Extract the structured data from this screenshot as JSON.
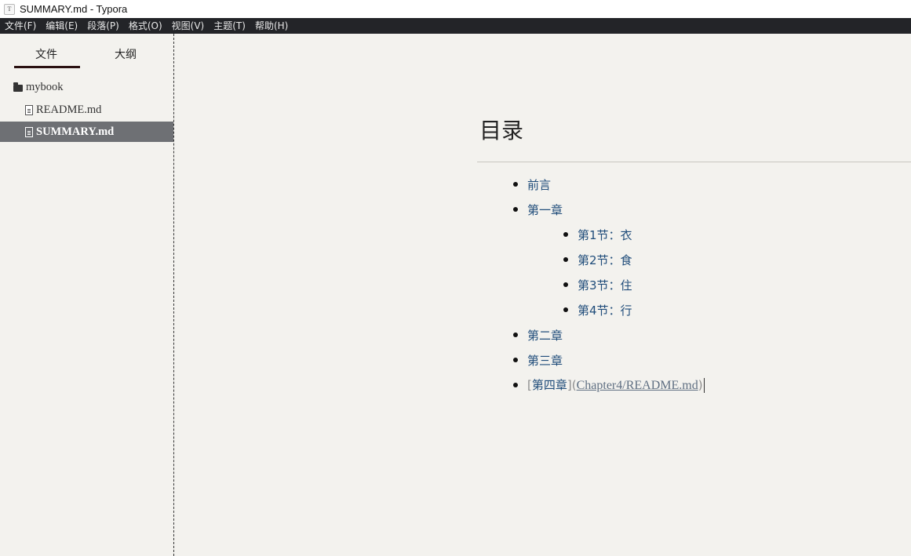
{
  "window": {
    "title": "SUMMARY.md - Typora",
    "icon": "T"
  },
  "menu": [
    "文件(F)",
    "编辑(E)",
    "段落(P)",
    "格式(O)",
    "视图(V)",
    "主题(T)",
    "帮助(H)"
  ],
  "sidebar": {
    "tabs": {
      "files": "文件",
      "outline": "大纲"
    },
    "tree": {
      "folder": "mybook",
      "files": [
        "README.md",
        "SUMMARY.md"
      ]
    }
  },
  "document": {
    "heading": "目录",
    "items": {
      "preface": "前言",
      "chapter1": "第一章",
      "sec1": "第1节：衣",
      "sec2": "第2节：食",
      "sec3": "第3节：住",
      "sec4": "第4节：行",
      "chapter2": "第二章",
      "chapter3": "第三章",
      "chapter4_open": "[",
      "chapter4_text": "第四章",
      "chapter4_mid": "](",
      "chapter4_url": "Chapter4/README.md",
      "chapter4_close": ")"
    }
  }
}
